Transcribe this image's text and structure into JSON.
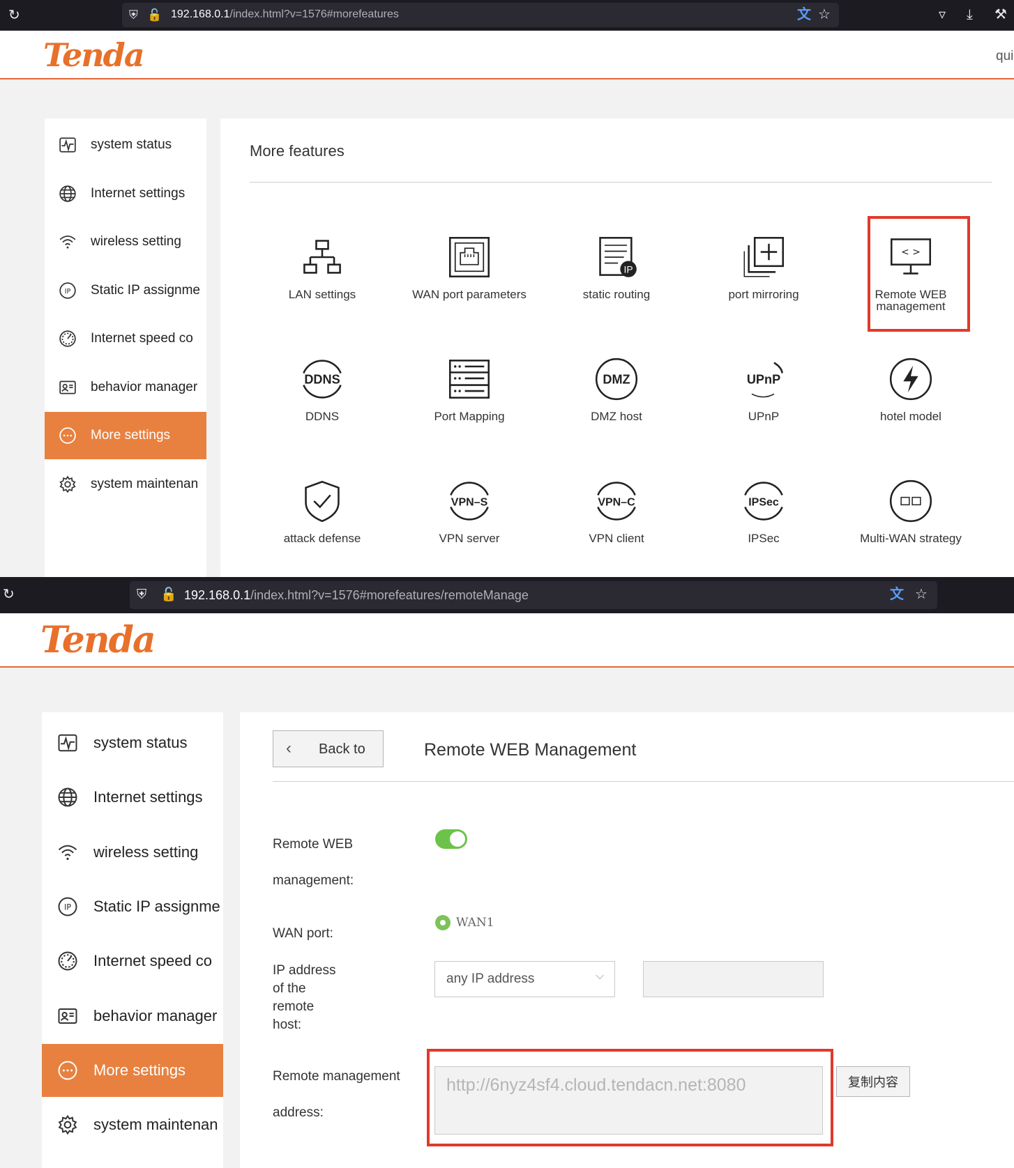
{
  "top": {
    "browser": {
      "url_host": "192.168.0.1",
      "url_rest": "/index.html?v=1576#morefeatures"
    },
    "header": {
      "logo": "Tenda",
      "right_text": "qui"
    },
    "sidebar": [
      {
        "label": "system status",
        "icon": "pulse-icon"
      },
      {
        "label": "Internet settings",
        "icon": "globe-icon"
      },
      {
        "label": "wireless setting",
        "icon": "wifi-icon"
      },
      {
        "label": "Static IP assignme",
        "icon": "ip-icon"
      },
      {
        "label": "Internet speed co",
        "icon": "speedometer-icon"
      },
      {
        "label": "behavior manager",
        "icon": "profile-card-icon"
      },
      {
        "label": "More settings",
        "icon": "more-dots-icon",
        "active": true
      },
      {
        "label": "system maintenan",
        "icon": "gear-icon"
      }
    ],
    "page_title": "More features",
    "features": [
      {
        "label": "LAN settings",
        "icon": "lan-icon"
      },
      {
        "label": "WAN port parameters",
        "icon": "ethernet-port-icon"
      },
      {
        "label": "static routing",
        "icon": "static-routing-icon"
      },
      {
        "label": "port mirroring",
        "icon": "port-mirroring-icon"
      },
      {
        "label": "Remote WEB\nmanagement",
        "icon": "monitor-code-icon"
      },
      {
        "label": "DDNS",
        "icon": "ddns-icon",
        "badge": "DDNS"
      },
      {
        "label": "Port Mapping",
        "icon": "port-mapping-icon"
      },
      {
        "label": "DMZ host",
        "icon": "dmz-icon",
        "badge": "DMZ"
      },
      {
        "label": "UPnP",
        "icon": "upnp-icon",
        "badge": "UPnP"
      },
      {
        "label": "hotel model",
        "icon": "lightning-icon"
      },
      {
        "label": "attack defense",
        "icon": "shield-check-icon"
      },
      {
        "label": "VPN server",
        "icon": "vpn-server-icon",
        "badge": "VPN–S"
      },
      {
        "label": "VPN client",
        "icon": "vpn-client-icon",
        "badge": "VPN–C"
      },
      {
        "label": "IPSec",
        "icon": "ipsec-icon",
        "badge": "IPSec"
      },
      {
        "label": "Multi-WAN strategy",
        "icon": "multi-wan-icon"
      }
    ]
  },
  "bottom": {
    "browser": {
      "url_host": "192.168.0.1",
      "url_rest": "/index.html?v=1576#morefeatures/remoteManage"
    },
    "header": {
      "logo": "Tenda"
    },
    "sidebar": [
      {
        "label": "system status",
        "icon": "pulse-icon"
      },
      {
        "label": "Internet settings",
        "icon": "globe-icon"
      },
      {
        "label": "wireless setting",
        "icon": "wifi-icon"
      },
      {
        "label": "Static IP assignme",
        "icon": "ip-icon"
      },
      {
        "label": "Internet speed co",
        "icon": "speedometer-icon"
      },
      {
        "label": "behavior manager",
        "icon": "profile-card-icon"
      },
      {
        "label": "More settings",
        "icon": "more-dots-icon",
        "active": true
      },
      {
        "label": "system maintenan",
        "icon": "gear-icon"
      }
    ],
    "back_label": "Back to",
    "page_title": "Remote WEB Management",
    "form": {
      "remote_web_label_1": "Remote WEB",
      "remote_web_label_2": "management:",
      "remote_web_enabled": true,
      "wan_port_label": "WAN port:",
      "wan_option": "WAN1",
      "ip_label_lines": [
        "IP address",
        "of the",
        "remote",
        "host:"
      ],
      "ip_select_value": "any IP address",
      "ip_text_value": "",
      "addr_label_1": "Remote management",
      "addr_label_2": "address:",
      "addr_value": "http://6nyz4sf4.cloud.tendacn.net:8080",
      "copy_button": "复制内容"
    }
  },
  "colors": {
    "accent": "#e8813f",
    "highlight_box": "#e03a2b",
    "toggle_on": "#6cc24a",
    "browser_bar": "#1c1b22"
  }
}
